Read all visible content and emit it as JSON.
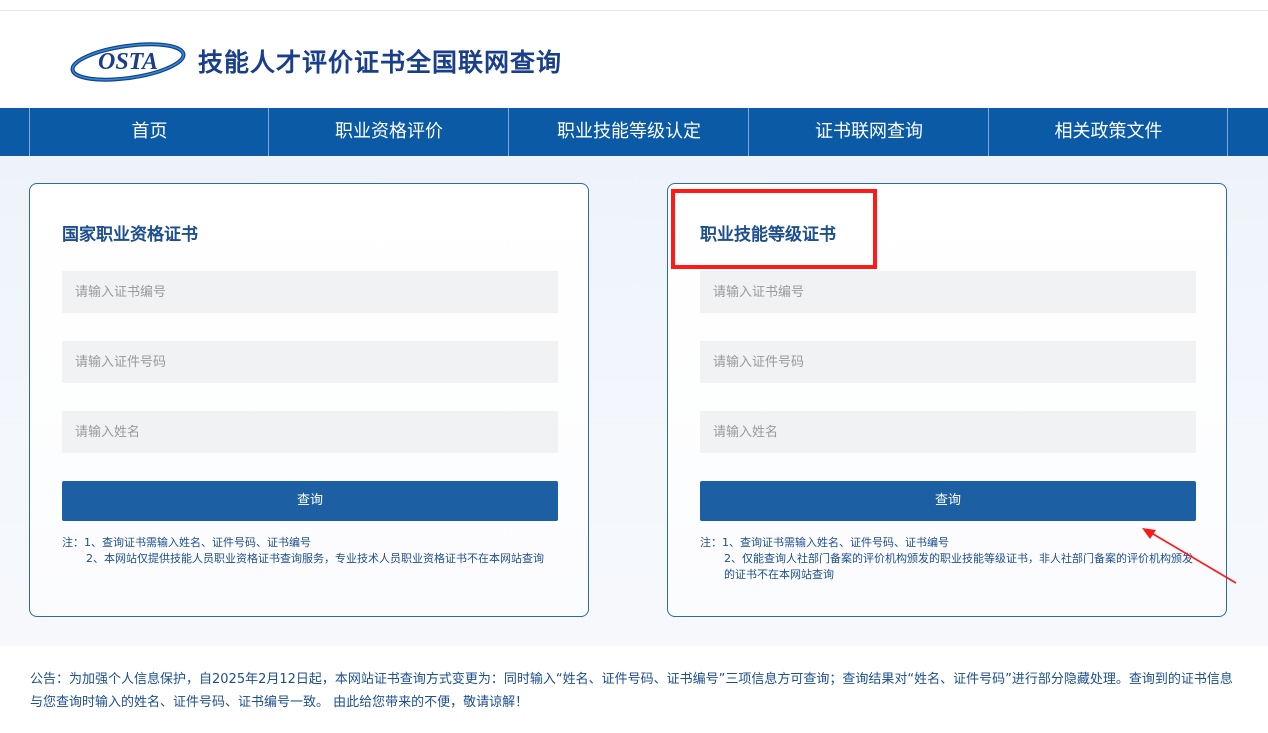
{
  "site": {
    "logo_text": "OSTA",
    "title": "技能人才评价证书全国联网查询"
  },
  "nav": {
    "items": [
      {
        "label": "首页"
      },
      {
        "label": "职业资格评价"
      },
      {
        "label": "职业技能等级认定"
      },
      {
        "label": "证书联网查询"
      },
      {
        "label": "相关政策文件"
      }
    ]
  },
  "left_card": {
    "title": "国家职业资格证书",
    "cert_no_placeholder": "请输入证书编号",
    "id_no_placeholder": "请输入证件号码",
    "name_placeholder": "请输入姓名",
    "button": "查询",
    "note_prefix": "注：",
    "note1": "1、查询证书需输入姓名、证件号码、证书编号",
    "note2": "2、本网站仅提供技能人员职业资格证书查询服务，专业技术人员职业资格证书不在本网站查询"
  },
  "right_card": {
    "title": "职业技能等级证书",
    "cert_no_placeholder": "请输入证书编号",
    "id_no_placeholder": "请输入证件号码",
    "name_placeholder": "请输入姓名",
    "button": "查询",
    "note_prefix": "注：",
    "note1": "1、查询证书需输入姓名、证件号码、证书编号",
    "note2": "2、仅能查询人社部门备案的评价机构颁发的职业技能等级证书，非人社部门备案的评价机构颁发的证书不在本网站查询"
  },
  "announcement": "公告：为加强个人信息保护，自2025年2月12日起，本网站证书查询方式变更为：同时输入“姓名、证件号码、证书编号”三项信息方可查询；查询结果对“姓名、证件号码”进行部分隐藏处理。查询到的证书信息与您查询时输入的姓名、证件号码、证书编号一致。 由此给您带来的不便，敬请谅解！",
  "colors": {
    "nav_bg": "#0b5aa6",
    "accent": "#1c5fa3",
    "highlight": "#ff1a1a"
  }
}
